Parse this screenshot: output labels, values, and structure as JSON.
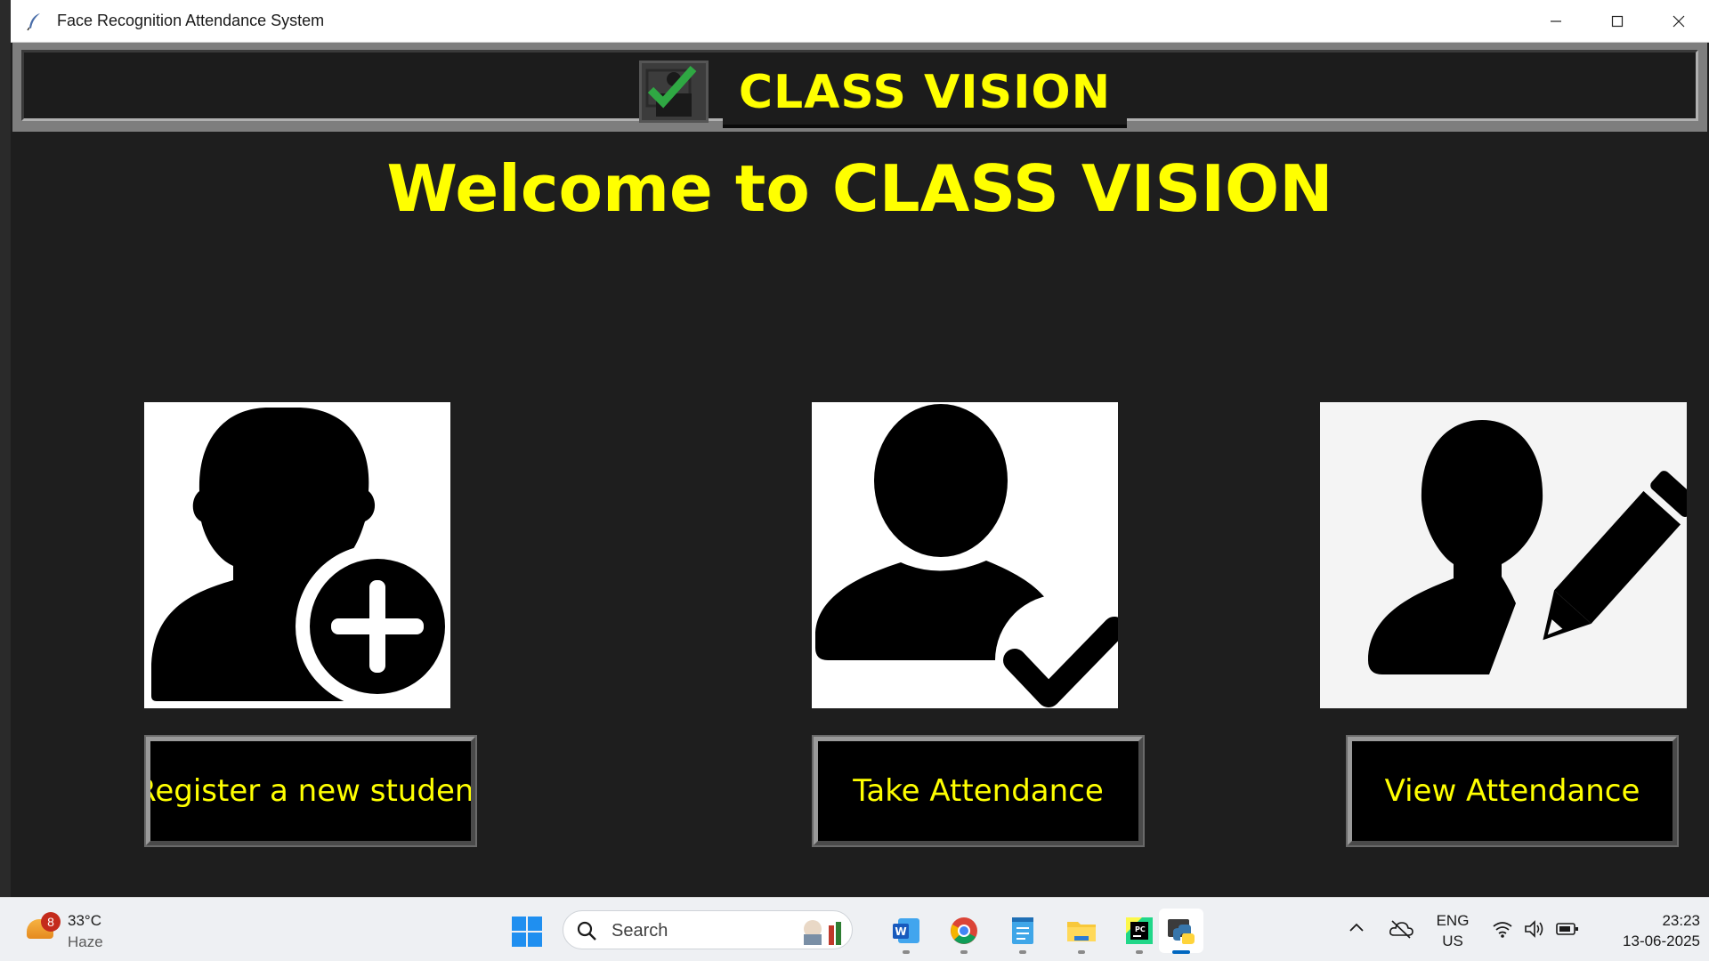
{
  "window": {
    "title": "Face Recognition Attendance System"
  },
  "header": {
    "brand": "CLASS VISION",
    "accent_color": "#ffff00",
    "logo_icon": "attendance-check-icon"
  },
  "main": {
    "welcome": "Welcome to CLASS VISION",
    "cards": [
      {
        "icon": "user-add-icon",
        "button_label": "Register a new student"
      },
      {
        "icon": "user-check-icon",
        "button_label": "Take Attendance"
      },
      {
        "icon": "user-edit-icon",
        "button_label": "View Attendance"
      }
    ]
  },
  "taskbar": {
    "weather": {
      "badge": "8",
      "temp": "33°C",
      "condition": "Haze"
    },
    "search": {
      "placeholder": "Search"
    },
    "apps": [
      "word-icon",
      "chrome-icon",
      "notepad-icon",
      "file-explorer-icon",
      "pycharm-icon",
      "python-icon"
    ],
    "language": {
      "line1": "ENG",
      "line2": "US"
    },
    "clock": {
      "time": "23:23",
      "date": "13-06-2025"
    }
  }
}
